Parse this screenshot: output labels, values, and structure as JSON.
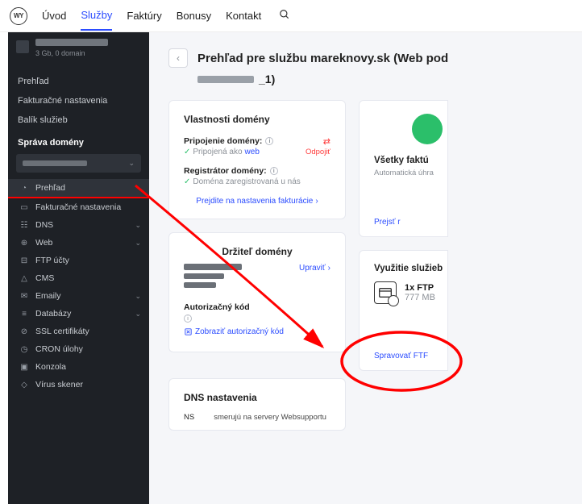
{
  "topnav": {
    "items": [
      "Úvod",
      "Služby",
      "Faktúry",
      "Bonusy",
      "Kontakt"
    ],
    "active_index": 1
  },
  "sidebar": {
    "account_sub": "3 Gb, 0 domain",
    "section1": [
      "Prehľad",
      "Fakturačné nastavenia",
      "Balík služieb"
    ],
    "group_title": "Správa domény",
    "rows": [
      {
        "icon": "gauge",
        "label": "Prehľad",
        "active": true
      },
      {
        "icon": "card",
        "label": "Fakturačné nastavenia"
      },
      {
        "icon": "dns",
        "label": "DNS",
        "chev": true
      },
      {
        "icon": "globe",
        "label": "Web",
        "chev": true
      },
      {
        "icon": "folder",
        "label": "FTP účty"
      },
      {
        "icon": "lock",
        "label": "CMS"
      },
      {
        "icon": "mail",
        "label": "Emaily",
        "chev": true
      },
      {
        "icon": "db",
        "label": "Databázy",
        "chev": true
      },
      {
        "icon": "cert",
        "label": "SSL certifikáty"
      },
      {
        "icon": "clock",
        "label": "CRON úlohy"
      },
      {
        "icon": "terminal",
        "label": "Konzola"
      },
      {
        "icon": "shield",
        "label": "Vírus skener"
      }
    ]
  },
  "main": {
    "title": "Prehľad pre službu mareknovy.sk (Web pod",
    "title_suffix": "_1)",
    "domain_props": {
      "heading": "Vlastnosti domény",
      "conn_label": "Pripojenie domény:",
      "conn_value_prefix": "Pripojená ako ",
      "conn_value_link": "web",
      "disconnect": "Odpojiť",
      "reg_label": "Registrátor domény:",
      "reg_value": "Doména zaregistrovaná u nás",
      "billing_link": "Prejdite na nastavenia fakturácie"
    },
    "holder": {
      "heading": "Držiteľ domény",
      "edit": "Upraviť",
      "auth_label": "Autorizačný kód",
      "auth_link": "Zobraziť autorizačný kód"
    },
    "dns": {
      "heading": "DNS nastavenia",
      "ns_key": "NS",
      "ns_val": "smerujú na servery Websupportu"
    },
    "right": {
      "invoices_title": "Všetky faktú",
      "invoices_sub": "Automatická úhra",
      "invoices_link": "Prejsť r",
      "usage_title": "Využitie služieb",
      "ftp_line1": "1x FTP",
      "ftp_line2": "777 MB",
      "ftp_link": "Spravovať FTF"
    }
  }
}
